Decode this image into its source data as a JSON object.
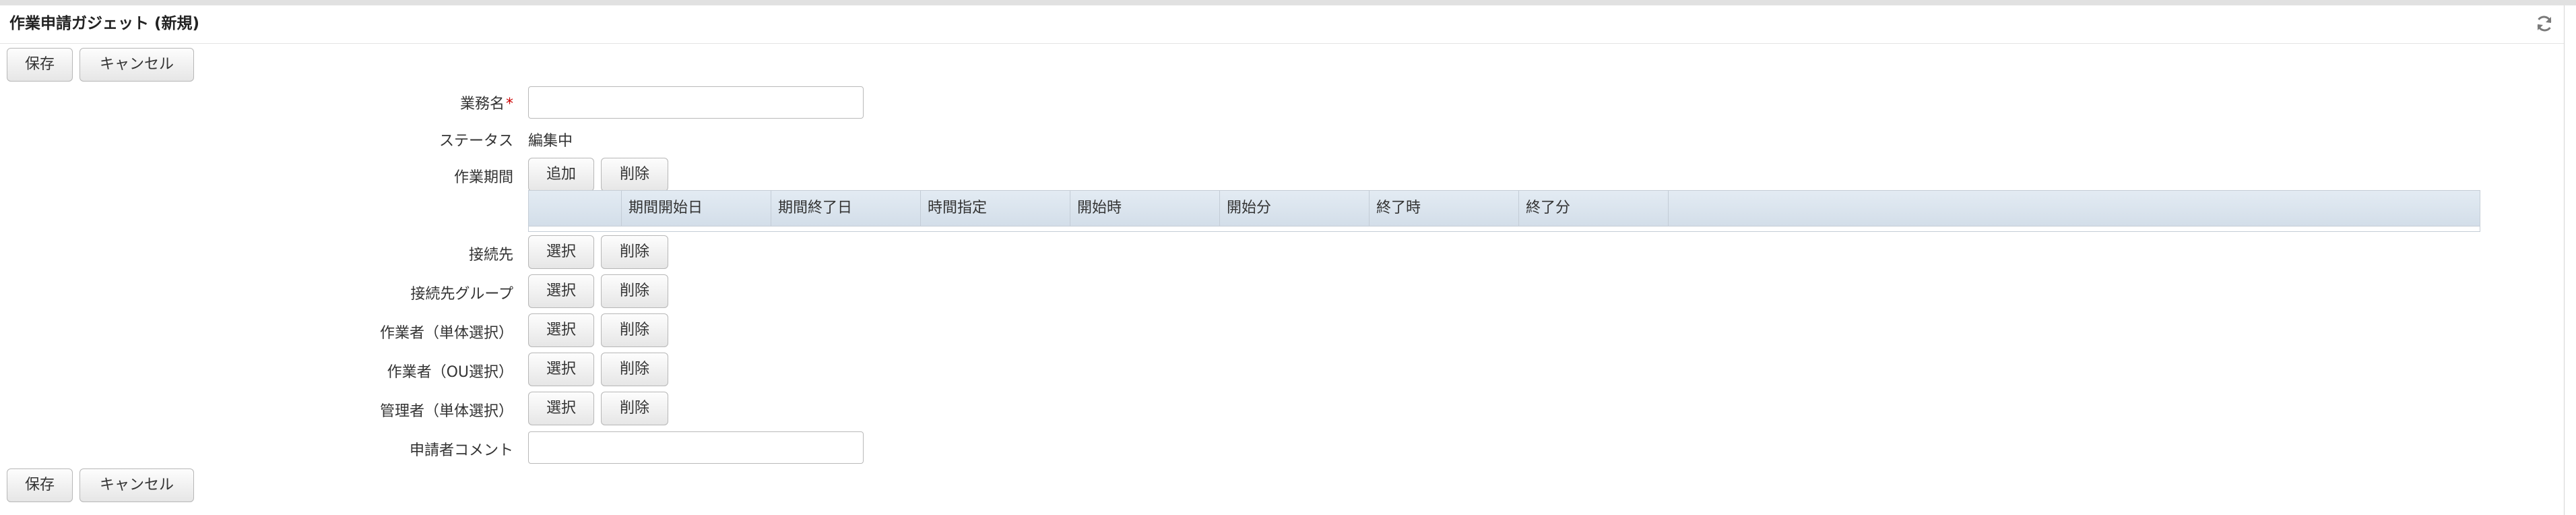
{
  "panel": {
    "title": "作業申請ガジェット (新規)",
    "refresh_icon": "refresh-icon"
  },
  "toolbar": {
    "save_label": "保存",
    "cancel_label": "キャンセル"
  },
  "form": {
    "task_name": {
      "label": "業務名",
      "required_mark": "*",
      "value": ""
    },
    "status": {
      "label": "ステータス",
      "value": "編集中"
    },
    "work_period": {
      "label": "作業期間",
      "add_label": "追加",
      "delete_label": "削除",
      "columns": [
        "",
        "期間開始日",
        "期間終了日",
        "時間指定",
        "開始時",
        "開始分",
        "終了時",
        "終了分"
      ]
    },
    "connection": {
      "label": "接続先",
      "select_label": "選択",
      "delete_label": "削除"
    },
    "connection_group": {
      "label": "接続先グループ",
      "select_label": "選択",
      "delete_label": "削除"
    },
    "worker_single": {
      "label": "作業者（単体選択）",
      "select_label": "選択",
      "delete_label": "削除"
    },
    "worker_ou": {
      "label": "作業者（OU選択）",
      "select_label": "選択",
      "delete_label": "削除"
    },
    "manager_single": {
      "label": "管理者（単体選択）",
      "select_label": "選択",
      "delete_label": "削除"
    },
    "applicant_comment": {
      "label": "申請者コメント",
      "value": ""
    }
  },
  "colors": {
    "header_grid_bg": "#dbe4ee",
    "required": "#cc0000",
    "button_border": "#b7b7b7"
  }
}
